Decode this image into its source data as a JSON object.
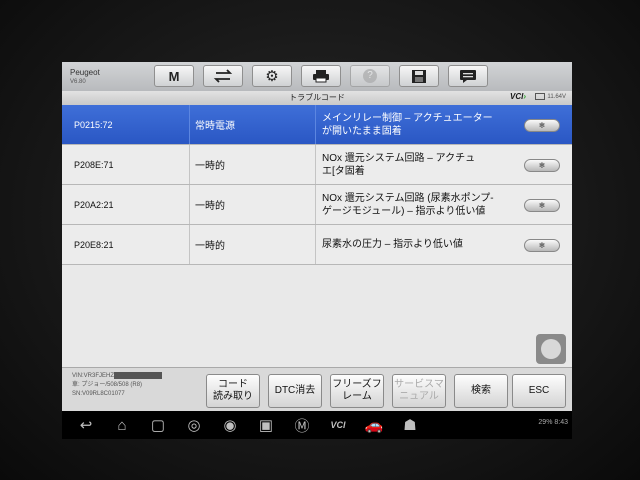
{
  "app": {
    "name": "Peugeot",
    "version": "V6.80"
  },
  "toolbar": {
    "buttons": [
      {
        "icon": "home-m-icon",
        "glyph": "M"
      },
      {
        "icon": "vehicle-swap-icon",
        "glyph": "⇄"
      },
      {
        "icon": "gear-icon",
        "glyph": "⚙"
      },
      {
        "icon": "print-icon",
        "glyph": "▤"
      },
      {
        "icon": "help-icon",
        "glyph": "?"
      },
      {
        "icon": "save-icon",
        "glyph": "▣"
      },
      {
        "icon": "message-icon",
        "glyph": "▬"
      }
    ]
  },
  "header": {
    "title": "トラブルコード",
    "vci": "VCI",
    "battery": "11.64V"
  },
  "dtcs": [
    {
      "code": "P0215:72",
      "status": "常時電源",
      "description": [
        "メインリレー制御 – アクチュエーター",
        "が開いたまま固着"
      ],
      "selected": true
    },
    {
      "code": "P208E:71",
      "status": "一時的",
      "description": [
        "NOx 還元システム回路 – アクチュ",
        "エ[タ固着"
      ],
      "selected": false
    },
    {
      "code": "P20A2:21",
      "status": "一時的",
      "description": [
        "NOx 還元システム回路 (尿素水ポンプ-",
        "ゲージモジュール) – 指示より低い値"
      ],
      "selected": false
    },
    {
      "code": "P20E8:21",
      "status": "一時的",
      "description": [
        "尿素水の圧力 – 指示より低い値"
      ],
      "selected": false
    }
  ],
  "vehicle": {
    "vin_label": "VIN:VR3FJEHZ",
    "model": "車: プジョー/508/508 (R8)",
    "sn": "SN:V09RL8C01077"
  },
  "footer": {
    "buttons": [
      {
        "label": [
          "コード",
          "読み取り"
        ],
        "disabled": false
      },
      {
        "label": [
          "DTC消去"
        ],
        "disabled": false
      },
      {
        "label": [
          "フリーズフ",
          "レーム"
        ],
        "disabled": false
      },
      {
        "label": [
          "サービスマ",
          "ニュアル"
        ],
        "disabled": true
      },
      {
        "label": [
          "検索"
        ],
        "disabled": false
      },
      {
        "label": [
          "ESC"
        ],
        "disabled": false
      }
    ]
  },
  "statusbar": {
    "battery": "29%",
    "time": "8:43"
  }
}
